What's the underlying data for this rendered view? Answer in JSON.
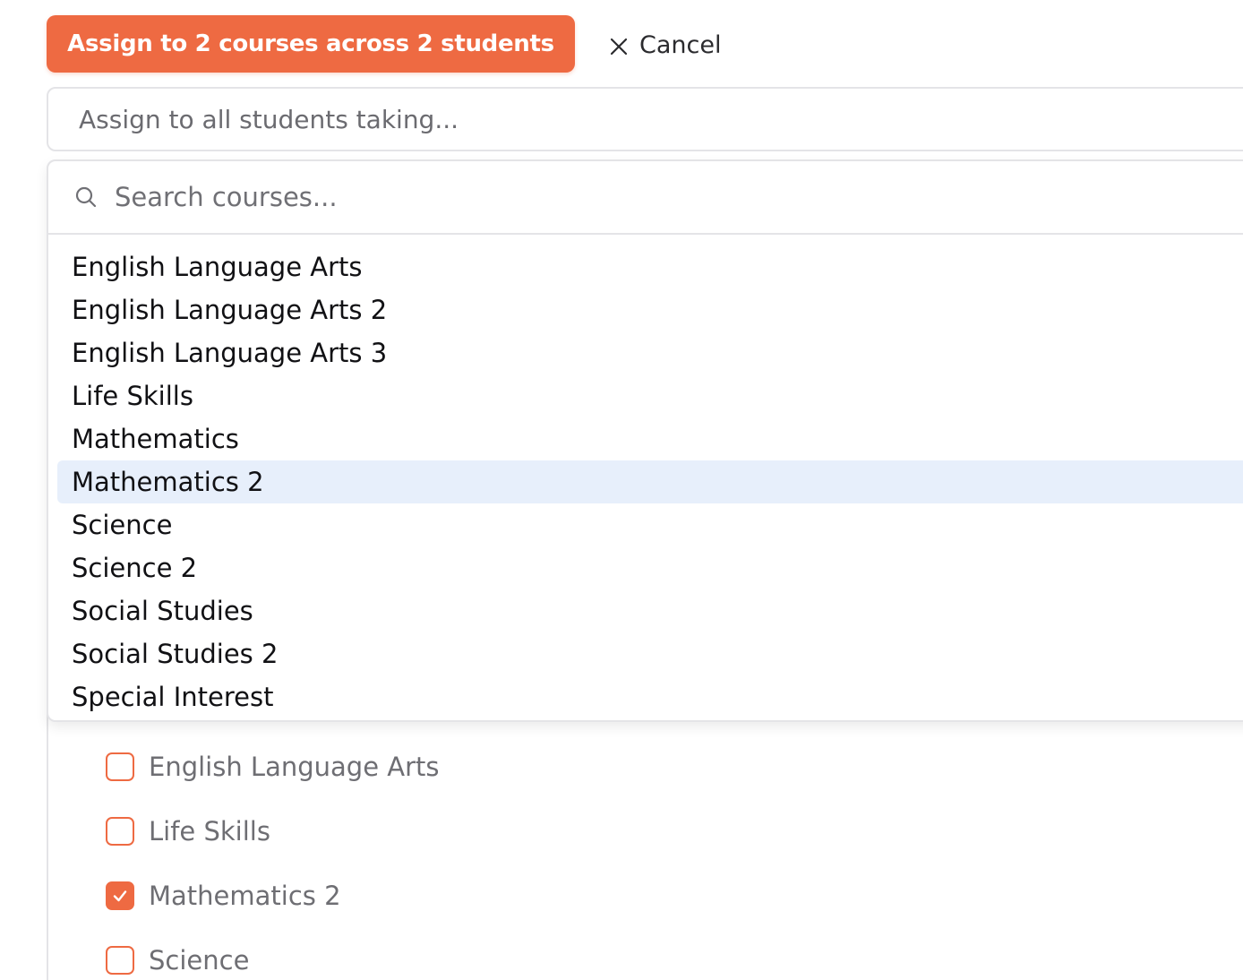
{
  "toolbar": {
    "assign_label": "Assign to 2 courses across 2 students",
    "cancel_label": "Cancel"
  },
  "assign_input": {
    "placeholder": "Assign to all students taking..."
  },
  "course_dropdown": {
    "search_placeholder": "Search courses...",
    "options": [
      "English Language Arts",
      "English Language Arts 2",
      "English Language Arts 3",
      "Life Skills",
      "Mathematics",
      "Mathematics 2",
      "Science",
      "Science 2",
      "Social Studies",
      "Social Studies 2",
      "Special Interest"
    ],
    "highlighted_index": 5
  },
  "course_checklist": [
    {
      "label": "English Language Arts",
      "checked": false
    },
    {
      "label": "Life Skills",
      "checked": false
    },
    {
      "label": "Mathematics 2",
      "checked": true
    },
    {
      "label": "Science",
      "checked": false
    }
  ],
  "colors": {
    "accent": "#ee6a42",
    "highlight": "#e7effb",
    "border": "#e4e4e7"
  }
}
